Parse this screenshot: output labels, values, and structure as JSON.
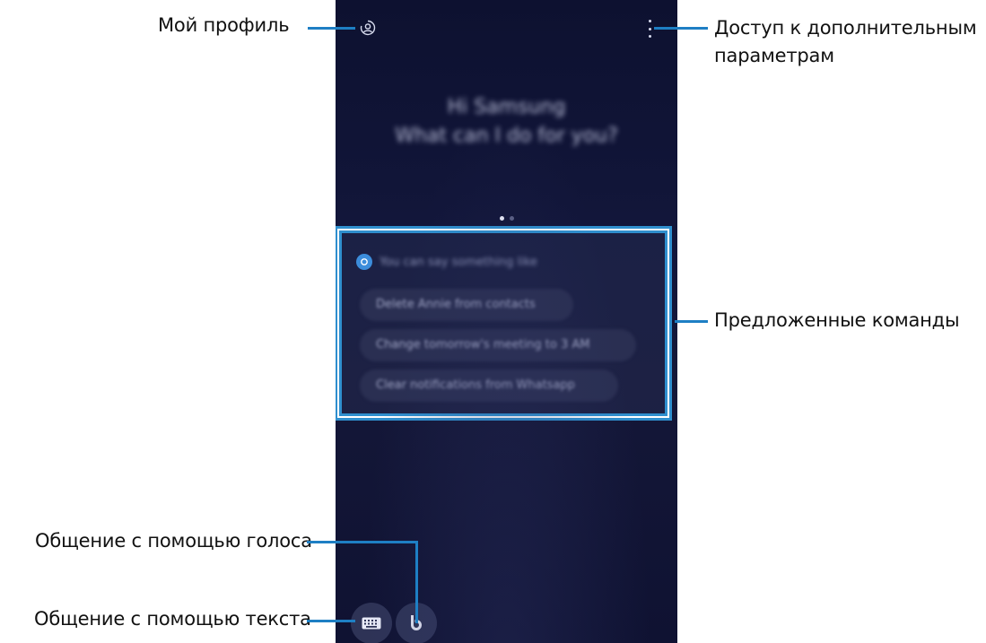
{
  "callouts": {
    "profile": "Мой профиль",
    "more_options_line1": "Доступ к дополнительным",
    "more_options_line2": "параметрам",
    "suggested_commands": "Предложенные команды",
    "voice_chat": "Общение с помощью голоса",
    "text_chat": "Общение с помощью текста"
  },
  "screen": {
    "greeting_line1": "Hi Samsung",
    "greeting_line2": "What can I do for you?",
    "suggestions_header": "You can say something like",
    "suggestions": [
      "Delete Annie from contacts",
      "Change tomorrow's meeting to 3 AM",
      "Clear notifications from Whatsapp"
    ]
  },
  "icons": {
    "profile": "profile-icon",
    "more": "more-options-icon",
    "suggestion": "bixby-suggestion-icon",
    "keyboard": "keyboard-icon",
    "voice": "bixby-voice-icon"
  },
  "colors": {
    "callout_line": "#1e7fc4",
    "screen_background": "#12163a",
    "highlight_border": "#2f8fce"
  }
}
